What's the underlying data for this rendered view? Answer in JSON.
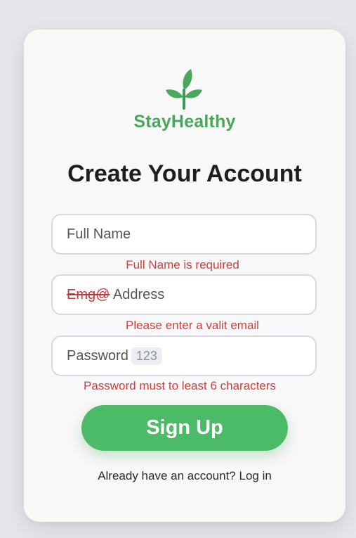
{
  "brand": {
    "name": "StayHealthy",
    "logo_icon": "leaf-sprout-icon",
    "color": "#4aa85c"
  },
  "form": {
    "title": "Create Your Account",
    "full_name": {
      "placeholder": "Full Name",
      "error": "Full Name is required"
    },
    "email": {
      "placeholder_struck": "Emg@",
      "placeholder_rest": " Address",
      "error": "Please enter a valit email"
    },
    "password": {
      "placeholder": "Password",
      "hint": "123",
      "error": "Password must to least 6 characters"
    },
    "submit_label": "Sign Up",
    "login_prompt": "Already have an account? Log in"
  },
  "colors": {
    "accent": "#4cbb67",
    "error": "#d23c3c"
  }
}
